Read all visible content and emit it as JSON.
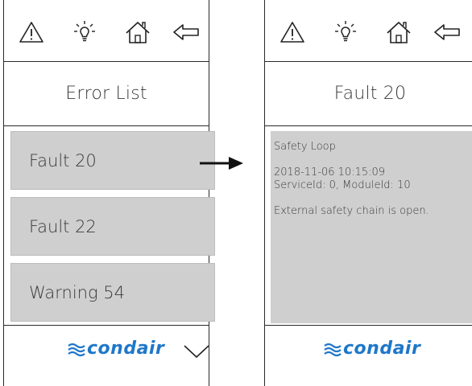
{
  "left_screen": {
    "title": "Error List",
    "items": [
      {
        "label": "Fault 20"
      },
      {
        "label": "Fault 22"
      },
      {
        "label": "Warning 54"
      }
    ],
    "logo_text": "condair"
  },
  "right_screen": {
    "title": "Fault 20",
    "detail": {
      "name": "Safety Loop",
      "timestamp": "2018-11-06 10:15:09",
      "ids": "ServiceId: 0, ModuleId: 10",
      "description": "External safety chain is open."
    },
    "logo_text": "condair"
  },
  "toolbar_icons": [
    "warning-icon",
    "lightbulb-icon",
    "home-icon",
    "back-arrow-icon"
  ],
  "colors": {
    "brand": "#1f77c9",
    "item_bg": "#cfcfcf",
    "line": "#2a2a2a"
  }
}
